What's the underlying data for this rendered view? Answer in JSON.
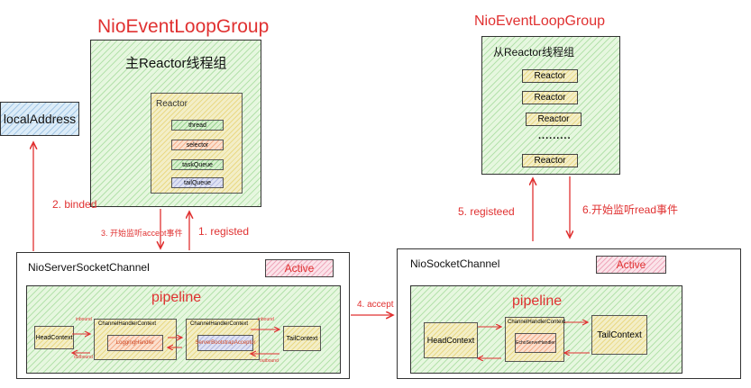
{
  "left": {
    "group_title": "NioEventLoopGroup",
    "group_label": "主Reactor线程组",
    "reactor_label": "Reactor",
    "reactor_items": [
      "thread",
      "selector",
      "taskQueue",
      "tailQueue"
    ],
    "local_address": "localAddress",
    "channel_title": "NioServerSocketChannel",
    "active_badge": "Active",
    "pipeline_label": "pipeline",
    "head_context": "HeadContext",
    "handler_context_1": "ChannelHandlerContext",
    "logging_handler": "LoggingHandler",
    "handler_context_2": "ChannelHandlerContext",
    "acceptor": "ServerBootstrapAcceptor",
    "tail_context": "TailContext",
    "inbound_1": "inbound",
    "inbound_2": "inbound",
    "outbound_1": "outbound",
    "outbound_2": "outbound"
  },
  "right": {
    "group_title": "NioEventLoopGroup",
    "group_label": "从Reactor线程组",
    "reactors": [
      "Reactor",
      "Reactor",
      "Reactor",
      "Reactor"
    ],
    "dots": ".........",
    "channel_title": "NioSocketChannel",
    "active_badge": "Active",
    "pipeline_label": "pipeline",
    "head_context": "HeadContext",
    "handler_context": "ChannelHandlerContext",
    "echo_handler": "EchoServerHandler",
    "tail_context": "TailContext"
  },
  "flows": {
    "binded": "2. binded",
    "accept_listen": "3. 开始监听accept事件",
    "registed": "1. registed",
    "accept": "4. accept",
    "registeed": "5. registeed",
    "read_listen": "6.开始监听read事件"
  },
  "colors": {
    "title_red": "#e03131",
    "arrow_red": "#e03131",
    "green_fill": "#e6f7df",
    "yellow_fill": "#f3eec7",
    "blue_fill": "#dcecf8"
  }
}
